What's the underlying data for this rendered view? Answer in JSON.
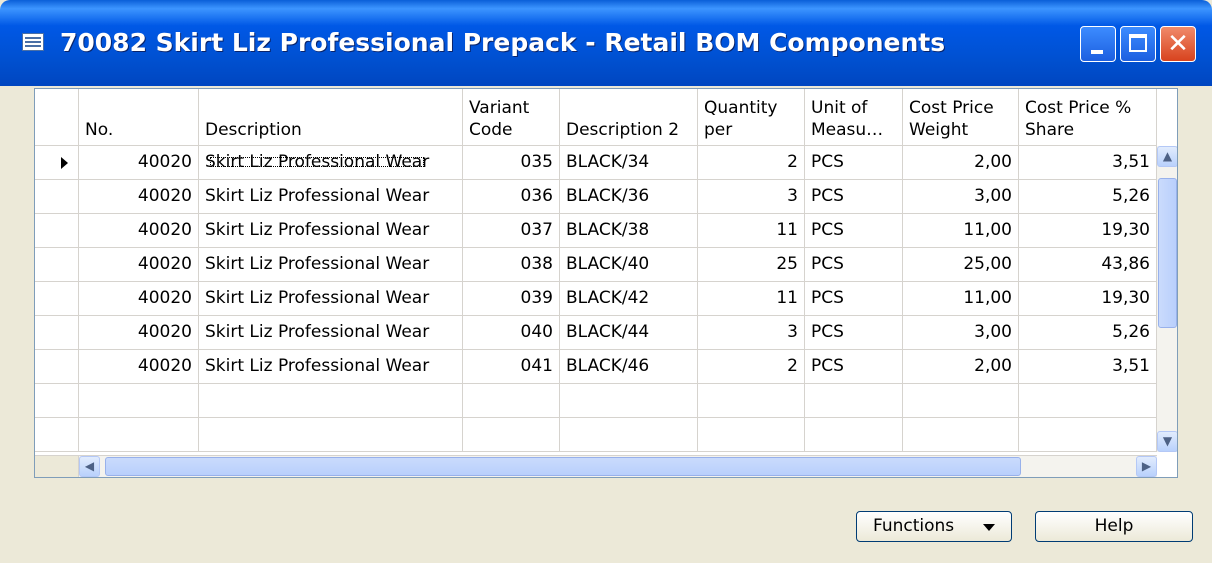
{
  "window": {
    "title": "70082 Skirt Liz Professional Prepack - Retail BOM Components",
    "icon": "table-form-icon"
  },
  "grid": {
    "columns": [
      {
        "key": "no",
        "label": "No."
      },
      {
        "key": "description",
        "label": "Description"
      },
      {
        "key": "variant_code",
        "label": "Variant\nCode"
      },
      {
        "key": "description2",
        "label": "Description 2"
      },
      {
        "key": "quantity_per",
        "label": "Quantity\nper"
      },
      {
        "key": "unit",
        "label": "Unit of\nMeasu…"
      },
      {
        "key": "cost_weight",
        "label": "Cost Price\nWeight"
      },
      {
        "key": "cost_share",
        "label": "Cost Price %\nShare"
      }
    ],
    "rows": [
      {
        "no": "40020",
        "description": "Skirt Liz Professional Wear",
        "variant_code": "035",
        "description2": "BLACK/34",
        "quantity_per": "2",
        "unit": "PCS",
        "cost_weight": "2,00",
        "cost_share": "3,51"
      },
      {
        "no": "40020",
        "description": "Skirt Liz Professional Wear",
        "variant_code": "036",
        "description2": "BLACK/36",
        "quantity_per": "3",
        "unit": "PCS",
        "cost_weight": "3,00",
        "cost_share": "5,26"
      },
      {
        "no": "40020",
        "description": "Skirt Liz Professional Wear",
        "variant_code": "037",
        "description2": "BLACK/38",
        "quantity_per": "11",
        "unit": "PCS",
        "cost_weight": "11,00",
        "cost_share": "19,30"
      },
      {
        "no": "40020",
        "description": "Skirt Liz Professional Wear",
        "variant_code": "038",
        "description2": "BLACK/40",
        "quantity_per": "25",
        "unit": "PCS",
        "cost_weight": "25,00",
        "cost_share": "43,86"
      },
      {
        "no": "40020",
        "description": "Skirt Liz Professional Wear",
        "variant_code": "039",
        "description2": "BLACK/42",
        "quantity_per": "11",
        "unit": "PCS",
        "cost_weight": "11,00",
        "cost_share": "19,30"
      },
      {
        "no": "40020",
        "description": "Skirt Liz Professional Wear",
        "variant_code": "040",
        "description2": "BLACK/44",
        "quantity_per": "3",
        "unit": "PCS",
        "cost_weight": "3,00",
        "cost_share": "5,26"
      },
      {
        "no": "40020",
        "description": "Skirt Liz Professional Wear",
        "variant_code": "041",
        "description2": "BLACK/46",
        "quantity_per": "2",
        "unit": "PCS",
        "cost_weight": "2,00",
        "cost_share": "3,51"
      },
      {
        "no": "",
        "description": "",
        "variant_code": "",
        "description2": "",
        "quantity_per": "",
        "unit": "",
        "cost_weight": "",
        "cost_share": ""
      },
      {
        "no": "",
        "description": "",
        "variant_code": "",
        "description2": "",
        "quantity_per": "",
        "unit": "",
        "cost_weight": "",
        "cost_share": ""
      }
    ],
    "selected_row": 0
  },
  "buttons": {
    "functions": "Functions",
    "help": "Help"
  }
}
